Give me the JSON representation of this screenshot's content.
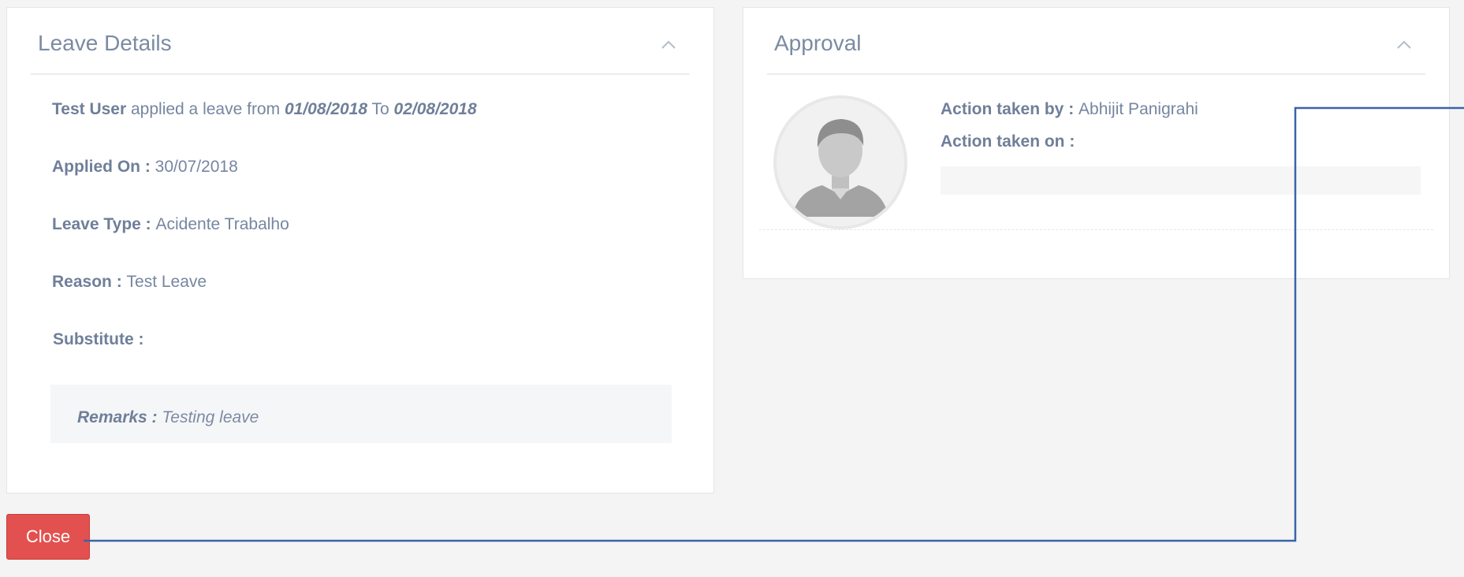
{
  "leave_details": {
    "title": "Leave Details",
    "applicant": "Test User",
    "applied_phrase": " applied a leave from ",
    "from_date": "01/08/2018",
    "to_word": " To ",
    "to_date": "02/08/2018",
    "applied_on_label": "Applied On : ",
    "applied_on_value": "30/07/2018",
    "leave_type_label": "Leave Type : ",
    "leave_type_value": "Acidente Trabalho",
    "reason_label": "Reason : ",
    "reason_value": "Test Leave",
    "substitute_label": "Substitute :",
    "remarks_label": "Remarks : ",
    "remarks_value": "Testing leave"
  },
  "approval": {
    "title": "Approval",
    "action_by_label": "Action taken by : ",
    "action_by_value": "Abhijit Panigrahi",
    "action_on_label": "Action taken on :"
  },
  "footer": {
    "close_label": "Close"
  },
  "colors": {
    "close_button": "#e2514f",
    "connector_line": "#3b63a8"
  },
  "icons": {
    "collapse": "chevron-up-icon",
    "avatar": "user-avatar-icon"
  }
}
